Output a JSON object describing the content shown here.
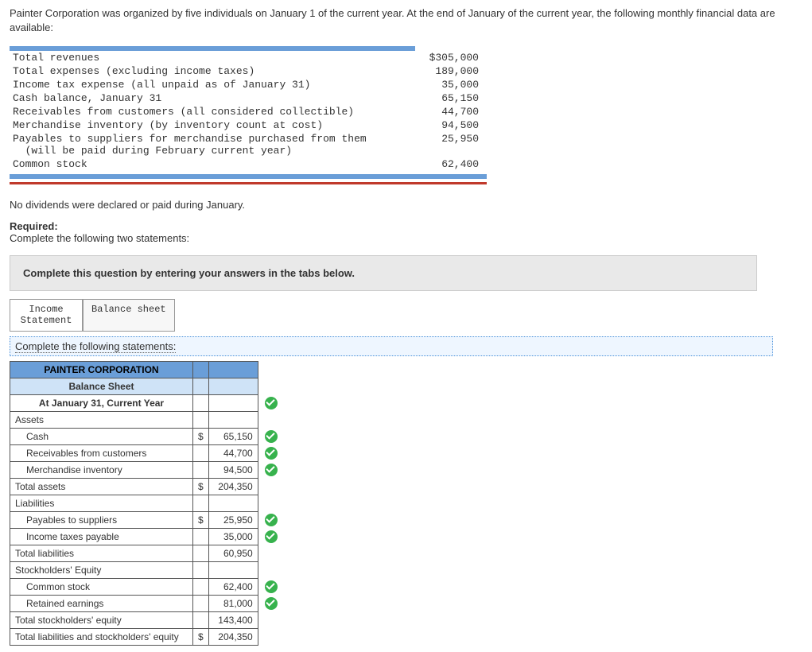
{
  "intro": "Painter Corporation was organized by five individuals on January 1 of the current year. At the end of January of the current year, the following monthly financial data are available:",
  "given": [
    {
      "label": "Total revenues",
      "amount": "$305,000"
    },
    {
      "label": "Total expenses (excluding income taxes)",
      "amount": "189,000"
    },
    {
      "label": "Income tax expense (all unpaid as of January 31)",
      "amount": "35,000"
    },
    {
      "label": "Cash balance, January 31",
      "amount": "65,150"
    },
    {
      "label": "Receivables from customers (all considered collectible)",
      "amount": "44,700"
    },
    {
      "label": "Merchandise inventory (by inventory count at cost)",
      "amount": "94,500"
    },
    {
      "label": "Payables to suppliers for merchandise purchased from them\n  (will be paid during February current year)",
      "amount": "25,950"
    },
    {
      "label": "Common stock",
      "amount": "62,400"
    }
  ],
  "note": "No dividends were declared or paid during January.",
  "required_label": "Required:",
  "required_text": "Complete the following two statements:",
  "instruction_box": "Complete this question by entering your answers in the tabs below.",
  "tabs": {
    "income": "Income\nStatement",
    "balance": "Balance sheet"
  },
  "subinstruction": "Complete the following statements:",
  "balance_sheet": {
    "title1": "PAINTER CORPORATION",
    "title2": "Balance Sheet",
    "title3": "At January 31, Current Year",
    "sections": {
      "assets_hdr": "Assets",
      "cash": {
        "label": "Cash",
        "cur": "$",
        "val": "65,150"
      },
      "recv": {
        "label": "Receivables from customers",
        "cur": "",
        "val": "44,700"
      },
      "inv": {
        "label": "Merchandise inventory",
        "cur": "",
        "val": "94,500"
      },
      "total_assets": {
        "label": "Total assets",
        "cur": "$",
        "val": "204,350"
      },
      "liab_hdr": "Liabilities",
      "pay": {
        "label": "Payables to suppliers",
        "cur": "$",
        "val": "25,950"
      },
      "tax": {
        "label": "Income taxes payable",
        "cur": "",
        "val": "35,000"
      },
      "total_liab": {
        "label": "Total liabilities",
        "cur": "",
        "val": "60,950"
      },
      "se_hdr": "Stockholders' Equity",
      "cs": {
        "label": "Common stock",
        "cur": "",
        "val": "62,400"
      },
      "re": {
        "label": "Retained earnings",
        "cur": "",
        "val": "81,000"
      },
      "total_se": {
        "label": "Total stockholders' equity",
        "cur": "",
        "val": "143,400"
      },
      "total_all": {
        "label": "Total liabilities and stockholders' equity",
        "cur": "$",
        "val": "204,350"
      }
    }
  }
}
